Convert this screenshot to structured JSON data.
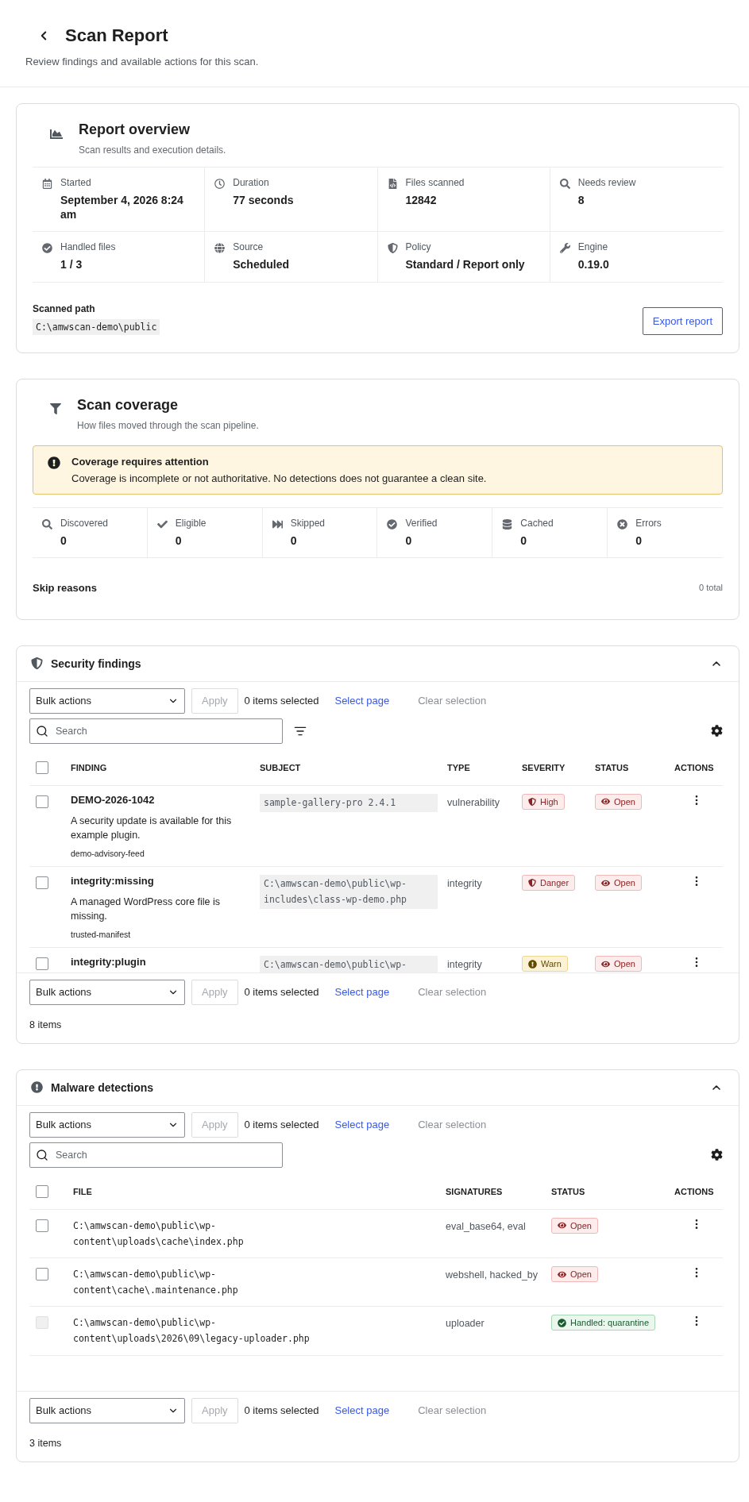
{
  "header": {
    "title": "Scan Report",
    "subtitle": "Review findings and available actions for this scan."
  },
  "overview": {
    "title": "Report overview",
    "subtitle": "Scan results and execution details.",
    "stats": [
      {
        "kind": "calendar",
        "label": "Started",
        "value": "September 4, 2026 8:24 am"
      },
      {
        "kind": "clock",
        "label": "Duration",
        "value": "77 seconds"
      },
      {
        "kind": "file",
        "label": "Files scanned",
        "value": "12842"
      },
      {
        "kind": "search",
        "label": "Needs review",
        "value": "8"
      },
      {
        "kind": "check",
        "label": "Handled files",
        "value": "1 / 3"
      },
      {
        "kind": "globe",
        "label": "Source",
        "value": "Scheduled"
      },
      {
        "kind": "shield",
        "label": "Policy",
        "value": "Standard / Report only"
      },
      {
        "kind": "wrench",
        "label": "Engine",
        "value": "0.19.0"
      }
    ],
    "path_label": "Scanned path",
    "path": "C:\\amwscan-demo\\public",
    "export_button": "Export report"
  },
  "coverage": {
    "title": "Scan coverage",
    "subtitle": "How files moved through the scan pipeline.",
    "alert": {
      "title": "Coverage requires attention",
      "message": "Coverage is incomplete or not authoritative. No detections does not guarantee a clean site."
    },
    "stages": [
      {
        "kind": "search",
        "label": "Discovered",
        "value": "0"
      },
      {
        "kind": "tick",
        "label": "Eligible",
        "value": "0"
      },
      {
        "kind": "skip",
        "label": "Skipped",
        "value": "0"
      },
      {
        "kind": "check",
        "label": "Verified",
        "value": "0"
      },
      {
        "kind": "database",
        "label": "Cached",
        "value": "0"
      },
      {
        "kind": "error",
        "label": "Errors",
        "value": "0"
      }
    ],
    "skip_reasons_label": "Skip reasons",
    "skip_reasons_total": "0 total"
  },
  "findings": {
    "title": "Security findings",
    "expanded": true,
    "all_selected": false,
    "toolbar_top": {
      "bulk": "Bulk actions",
      "apply": "Apply",
      "apply_disabled": true,
      "selected_count": "0 items selected",
      "select_page": "Select page",
      "clear_selection": "Clear selection",
      "clear_disabled": true
    },
    "search_placeholder": "Search",
    "columns": [
      "FINDING",
      "SUBJECT",
      "TYPE",
      "SEVERITY",
      "STATUS",
      "ACTIONS"
    ],
    "rows": [
      {
        "checked": false,
        "finding": "DEMO-2026-1042",
        "description": "A security update is available for this example plugin.",
        "source": "demo-advisory-feed",
        "subject": "sample-gallery-pro 2.4.1",
        "type": "vulnerability",
        "severity": {
          "kind": "danger",
          "label": "High"
        },
        "status": {
          "kind": "open",
          "label": "Open"
        }
      },
      {
        "checked": false,
        "finding": "integrity:missing",
        "description": "A managed WordPress core file is missing.",
        "source": "trusted-manifest",
        "subject": "C:\\amwscan-demo\\public\\wp-includes\\class-wp-demo.php",
        "type": "integrity",
        "severity": {
          "kind": "danger",
          "label": "Danger"
        },
        "status": {
          "kind": "open",
          "label": "Open"
        }
      },
      {
        "checked": false,
        "finding": "integrity:plugin",
        "subject": "C:\\amwscan-demo\\public\\wp-",
        "type": "integrity",
        "severity": {
          "kind": "warn",
          "label": "Warn"
        },
        "status": {
          "kind": "open",
          "label": "Open"
        }
      }
    ],
    "toolbar_bottom": {
      "bulk": "Bulk actions",
      "apply": "Apply",
      "apply_disabled": true,
      "selected_count": "0 items selected",
      "select_page": "Select page",
      "clear_selection": "Clear selection",
      "clear_disabled": true
    },
    "item_count": "8 items"
  },
  "malware": {
    "title": "Malware detections",
    "expanded": true,
    "all_selected": false,
    "toolbar_top": {
      "bulk": "Bulk actions",
      "apply": "Apply",
      "apply_disabled": true,
      "selected_count": "0 items selected",
      "select_page": "Select page",
      "clear_selection": "Clear selection",
      "clear_disabled": true
    },
    "search_placeholder": "Search",
    "columns": [
      "FILE",
      "SIGNATURES",
      "STATUS",
      "ACTIONS"
    ],
    "rows": [
      {
        "checked": false,
        "disabled": false,
        "file": "C:\\amwscan-demo\\public\\wp-content\\uploads\\cache\\index.php",
        "signatures": "eval_base64, eval",
        "status": {
          "kind": "open",
          "label": "Open"
        }
      },
      {
        "checked": false,
        "disabled": false,
        "file": "C:\\amwscan-demo\\public\\wp-content\\cache\\.maintenance.php",
        "signatures": "webshell, hacked_by",
        "status": {
          "kind": "open",
          "label": "Open"
        }
      },
      {
        "checked": false,
        "disabled": true,
        "file": "C:\\amwscan-demo\\public\\wp-content\\uploads\\2026\\09\\legacy-uploader.php",
        "signatures": "uploader",
        "status": {
          "kind": "handled",
          "label": "Handled: quarantine"
        }
      }
    ],
    "toolbar_bottom": {
      "bulk": "Bulk actions",
      "apply": "Apply",
      "apply_disabled": true,
      "selected_count": "0 items selected",
      "select_page": "Select page",
      "clear_selection": "Clear selection",
      "clear_disabled": true
    },
    "item_count": "3 items"
  }
}
